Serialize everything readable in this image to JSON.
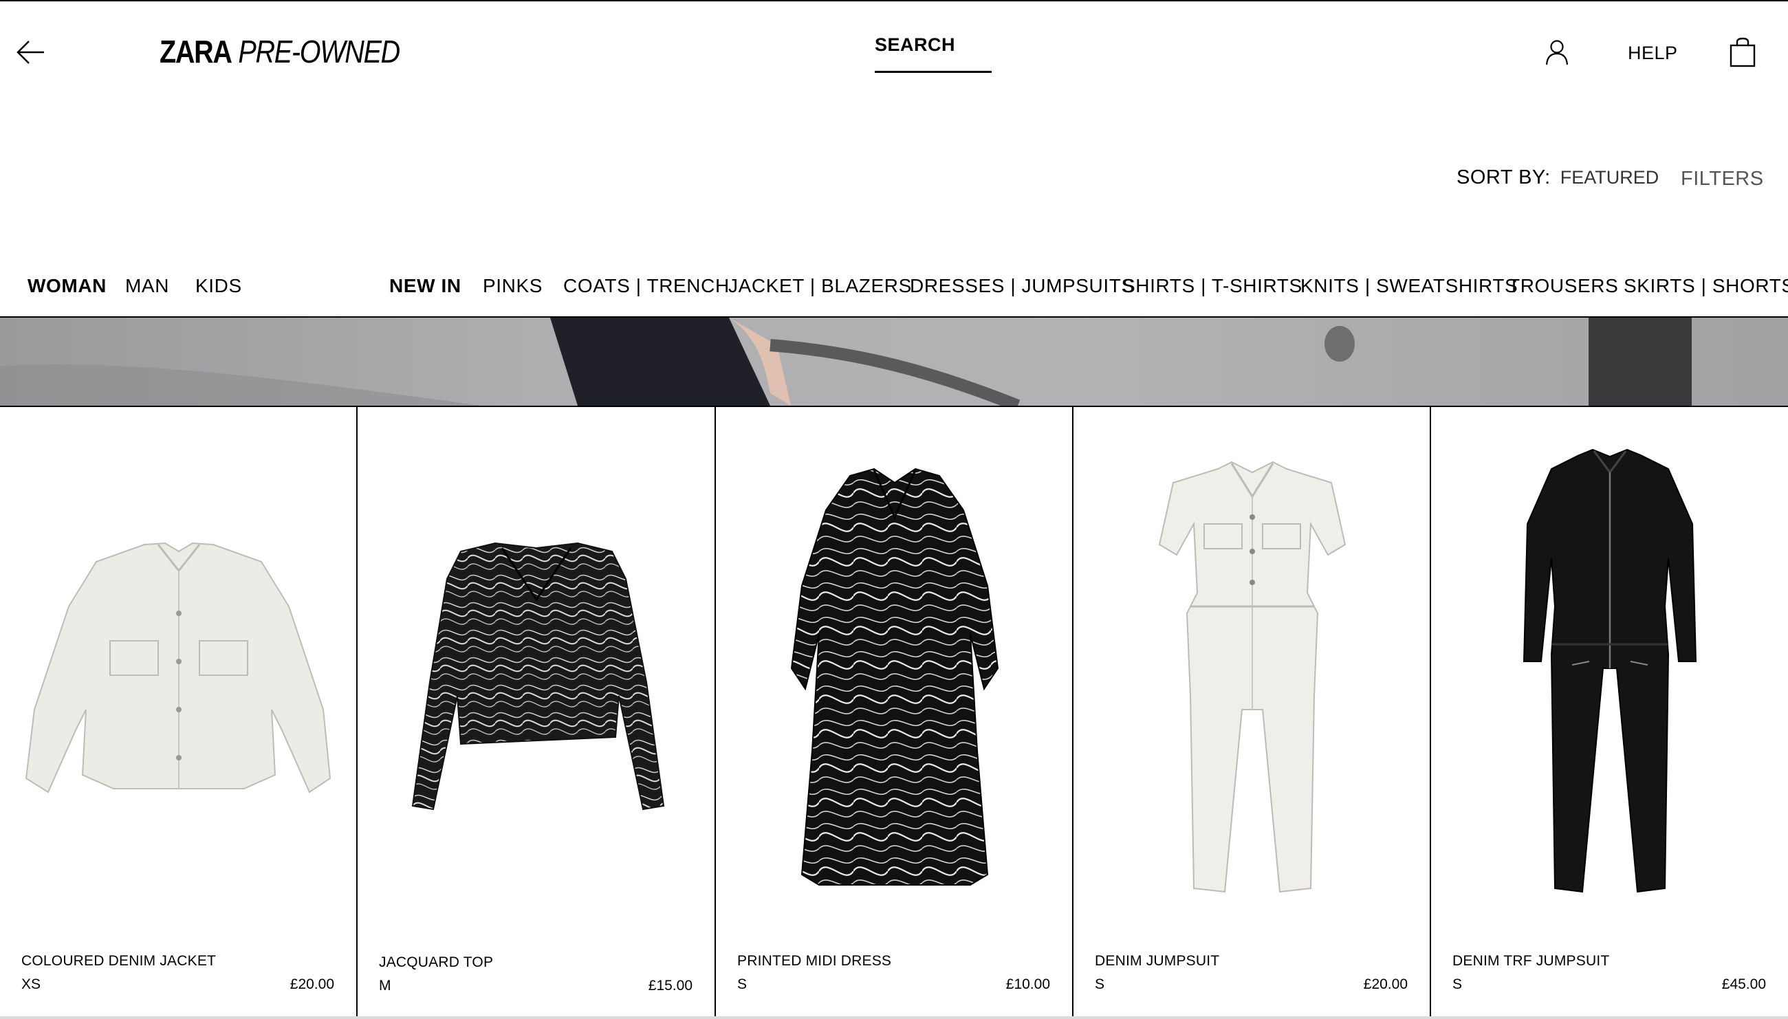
{
  "header": {
    "logo_brand": "ZARA",
    "logo_sub": "PRE-OWNED",
    "search_label": "SEARCH",
    "help_label": "HELP"
  },
  "sort": {
    "label": "SORT BY:",
    "value": "FEATURED",
    "filters_label": "FILTERS"
  },
  "nav": {
    "sections": [
      "WOMAN",
      "MAN",
      "KIDS"
    ],
    "categories": [
      "NEW IN",
      "PINKS",
      "COATS | TRENCH",
      "JACKET | BLAZERS",
      "DRESSES | JUMPSUITS",
      "SHIRTS | T-SHIRTS",
      "KNITS | SWEATSHIRTS",
      "TROUSERS",
      "SKIRTS | SHORTS"
    ],
    "active_section": "WOMAN",
    "active_category": "NEW IN"
  },
  "products": [
    {
      "name": "COLOURED DENIM JACKET",
      "size": "XS",
      "price": "£20.00",
      "color": "#ecebe6",
      "icon": "denim-jacket"
    },
    {
      "name": "JACQUARD TOP",
      "size": "M",
      "price": "£15.00",
      "color": "#1a1a1a",
      "icon": "cropped-top"
    },
    {
      "name": "PRINTED MIDI DRESS",
      "size": "S",
      "price": "£10.00",
      "color": "#111111",
      "icon": "midi-dress"
    },
    {
      "name": "DENIM JUMPSUIT",
      "size": "S",
      "price": "£20.00",
      "color": "#efeee9",
      "icon": "jumpsuit"
    },
    {
      "name": "DENIM TRF JUMPSUIT",
      "size": "S",
      "price": "£45.00",
      "color": "#141414",
      "icon": "jumpsuit"
    }
  ]
}
